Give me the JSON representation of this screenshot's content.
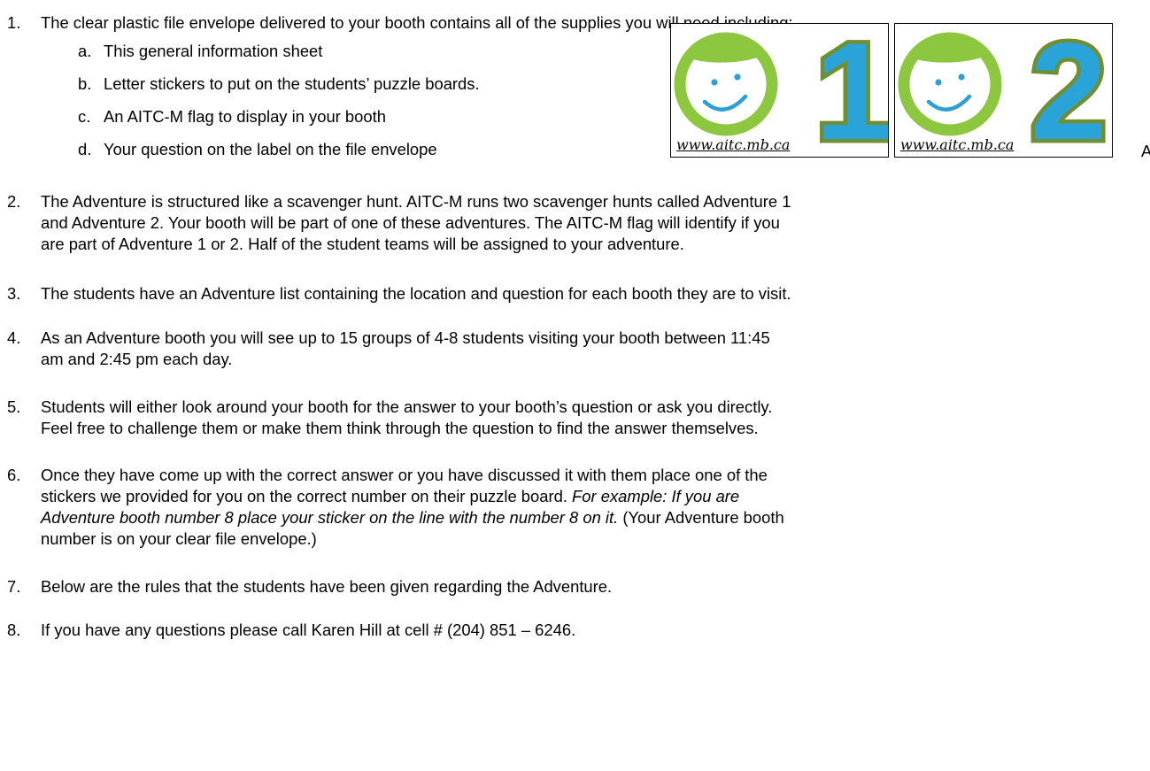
{
  "items": [
    {
      "num": "1.",
      "text": "The clear plastic file envelope delivered to your booth contains all of the supplies you will need including:"
    },
    {
      "num": "2.",
      "text": "The Adventure is structured like a scavenger hunt. AITC-M runs two scavenger hunts called Adventure 1\nand Adventure 2.  Your booth will be part of one of these adventures.  The AITC-M flag will identify if you\nare part of Adventure 1 or 2.  Half of the student teams will be assigned to your adventure."
    },
    {
      "num": "3.",
      "text": "The students have an Adventure list containing the location and question for each booth they are to visit."
    },
    {
      "num": "4.",
      "text": "As an Adventure booth you will see up to 15 groups of 4-8 students visiting your booth between 11:45\nam and 2:45 pm each day."
    },
    {
      "num": "5.",
      "text": "Students will either look around your booth for the answer to your booth’s question or ask you directly.\nFeel free to challenge them or make them think through the question to find the answer themselves."
    },
    {
      "num": "6.",
      "text_a": "Once they have come up with the correct answer or you have discussed it with them place one of the\nstickers we provided for you on the correct number on their puzzle board. ",
      "text_italic": "For example: If you are\nAdventure booth number 8 place your sticker on the line with the number 8 on it.",
      "text_b": " (Your Adventure booth\nnumber is on your clear file envelope.)"
    },
    {
      "num": "7.",
      "text": "Below are the rules that the students have been given regarding the Adventure."
    },
    {
      "num": "8.",
      "text": "If you have any questions please call Karen Hill at cell # (204) 851 – 6246."
    }
  ],
  "subitems": [
    {
      "letter": "a.",
      "text": "This general information sheet"
    },
    {
      "letter": "b.",
      "text": "Letter stickers to put on the students’ puzzle boards."
    },
    {
      "letter": "c.",
      "text": "An AITC-M flag to display in your booth"
    },
    {
      "letter": "d.",
      "text": "Your question on the label on the file envelope"
    }
  ],
  "logos": [
    {
      "digit": "1",
      "url": "www.aitc.mb.ca"
    },
    {
      "digit": "2",
      "url": "www.aitc.mb.ca"
    }
  ],
  "edge_text": "A",
  "colors": {
    "face_green": "#8dc63f",
    "smile_blue": "#2b9fd6",
    "digit_fill": "#29a3d8",
    "digit_outline": "#6f8f32"
  },
  "icons": [
    "smiley-face-icon"
  ]
}
